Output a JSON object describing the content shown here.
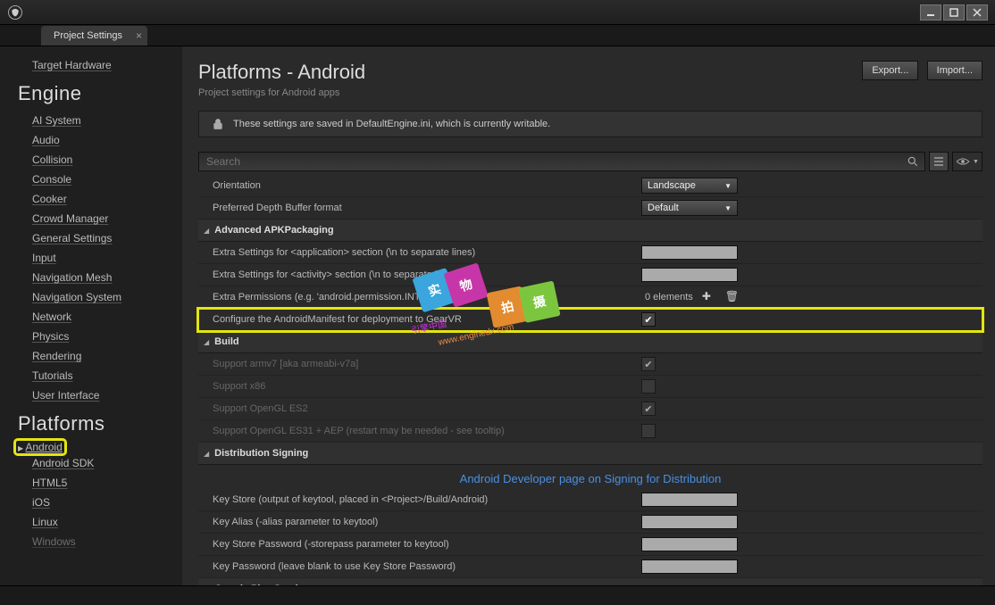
{
  "titlebar": {
    "app": "Unreal Editor"
  },
  "tab": {
    "label": "Project Settings"
  },
  "sidebar": {
    "top_items": [
      "Target Hardware"
    ],
    "engine_header": "Engine",
    "engine_items": [
      "AI System",
      "Audio",
      "Collision",
      "Console",
      "Cooker",
      "Crowd Manager",
      "General Settings",
      "Input",
      "Navigation Mesh",
      "Navigation System",
      "Network",
      "Physics",
      "Rendering",
      "Tutorials",
      "User Interface"
    ],
    "platforms_header": "Platforms",
    "platforms_items": [
      "Android",
      "Android SDK",
      "HTML5",
      "iOS",
      "Linux",
      "Windows"
    ],
    "selected": "Android"
  },
  "content": {
    "title": "Platforms - Android",
    "subtitle": "Project settings for Android apps",
    "export_btn": "Export...",
    "import_btn": "Import...",
    "infobar": "These settings are saved in DefaultEngine.ini, which is currently writable.",
    "search_placeholder": "Search",
    "link": "Android Developer page on Signing for Distribution",
    "rows": {
      "orientation_label": "Orientation",
      "orientation_value": "Landscape",
      "depth_label": "Preferred Depth Buffer format",
      "depth_value": "Default",
      "sec_apk": "Advanced APKPackaging",
      "extra_app": "Extra Settings for <application> section (\\n to separate lines)",
      "extra_act": "Extra Settings for <activity> section (\\n to separate lines)",
      "extra_perm": "Extra Permissions (e.g. 'android.permission.INTERNET')",
      "extra_perm_count": "0 elements",
      "gearvr": "Configure the AndroidManifest for deployment to GearVR",
      "sec_build": "Build",
      "armv7": "Support armv7 [aka armeabi-v7a]",
      "x86": "Support x86",
      "gles2": "Support OpenGL ES2",
      "gles31": "Support OpenGL ES31 + AEP (restart may be needed - see tooltip)",
      "sec_dist": "Distribution Signing",
      "keystore": "Key Store (output of keytool, placed in <Project>/Build/Android)",
      "keyalias": "Key Alias (-alias parameter to keytool)",
      "keystorepass": "Key Store Password (-storepass parameter to keytool)",
      "keypass": "Key Password (leave blank to use Key Store Password)",
      "sec_google": "Google Play Services"
    }
  },
  "watermark": {
    "badges": [
      "实",
      "物",
      "拍",
      "摄"
    ],
    "url1": "www.enginedx.com",
    "url2": "引擎中国"
  }
}
